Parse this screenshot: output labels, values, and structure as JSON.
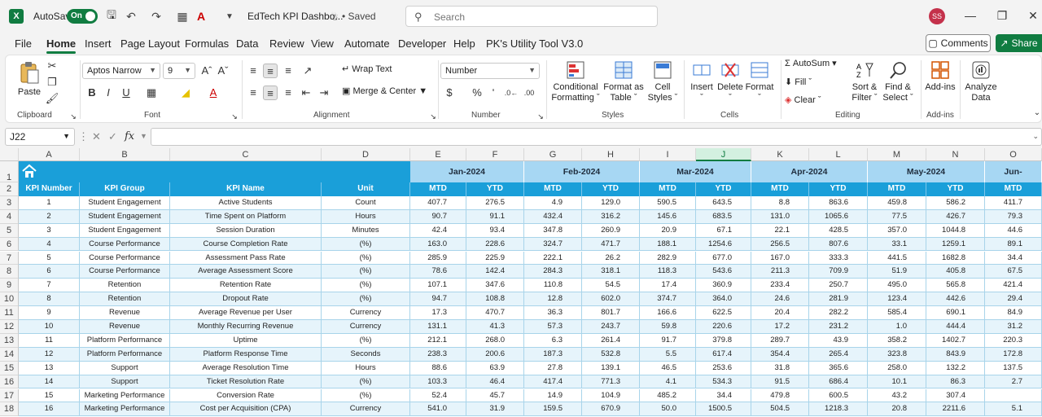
{
  "titlebar": {
    "autosave_label": "AutoSave",
    "autosave_state": "On",
    "doc_title": "EdTech KPI Dashbo...",
    "saved_status": "• Saved",
    "search_placeholder": "Search",
    "avatar_initials": "SS"
  },
  "menu": {
    "items": [
      "File",
      "Home",
      "Insert",
      "Page Layout",
      "Formulas",
      "Data",
      "Review",
      "View",
      "Automate",
      "Developer",
      "Help",
      "PK's Utility Tool V3.0"
    ],
    "active": "Home",
    "comments_label": "Comments",
    "share_label": "Share"
  },
  "ribbon": {
    "clipboard": {
      "paste": "Paste",
      "label": "Clipboard"
    },
    "font": {
      "name": "Aptos Narrow",
      "size": "9",
      "label": "Font"
    },
    "alignment": {
      "wrap": "Wrap Text",
      "merge": "Merge & Center",
      "label": "Alignment"
    },
    "number": {
      "format": "Number",
      "label": "Number"
    },
    "styles": {
      "conditional_1": "Conditional",
      "conditional_2": "Formatting",
      "format_table_1": "Format as",
      "format_table_2": "Table",
      "cell_styles_1": "Cell",
      "cell_styles_2": "Styles",
      "label": "Styles"
    },
    "cells": {
      "insert": "Insert",
      "delete": "Delete",
      "format": "Format",
      "label": "Cells"
    },
    "editing": {
      "autosum": "AutoSum",
      "fill": "Fill",
      "clear": "Clear",
      "sort_1": "Sort &",
      "sort_2": "Filter",
      "find_1": "Find &",
      "find_2": "Select",
      "label": "Editing"
    },
    "addins": {
      "button": "Add-ins",
      "label": "Add-ins"
    },
    "analyze": {
      "line1": "Analyze",
      "line2": "Data"
    }
  },
  "formula_bar": {
    "name_box": "J22",
    "fx": "fx",
    "content": ""
  },
  "sheet": {
    "selected_column": "J",
    "col_letters": [
      "A",
      "B",
      "C",
      "D",
      "E",
      "F",
      "G",
      "H",
      "I",
      "J",
      "K",
      "L",
      "M",
      "N",
      "O"
    ],
    "months": [
      "Jan-2024",
      "Feb-2024",
      "Mar-2024",
      "Apr-2024",
      "May-2024",
      "Jun-"
    ],
    "headers": [
      "KPI Number",
      "KPI Group",
      "KPI Name",
      "Unit",
      "MTD",
      "YTD",
      "MTD",
      "YTD",
      "MTD",
      "YTD",
      "MTD",
      "YTD",
      "MTD",
      "YTD",
      "MTD"
    ],
    "rows": [
      [
        "1",
        "Student Engagement",
        "Active Students",
        "Count",
        "407.7",
        "276.5",
        "4.9",
        "129.0",
        "590.5",
        "643.5",
        "8.8",
        "863.6",
        "459.8",
        "586.2",
        "411.7"
      ],
      [
        "2",
        "Student Engagement",
        "Time Spent on Platform",
        "Hours",
        "90.7",
        "91.1",
        "432.4",
        "316.2",
        "145.6",
        "683.5",
        "131.0",
        "1065.6",
        "77.5",
        "426.7",
        "79.3"
      ],
      [
        "3",
        "Student Engagement",
        "Session Duration",
        "Minutes",
        "42.4",
        "93.4",
        "347.8",
        "260.9",
        "20.9",
        "67.1",
        "22.1",
        "428.5",
        "357.0",
        "1044.8",
        "44.6"
      ],
      [
        "4",
        "Course Performance",
        "Course Completion Rate",
        "(%)",
        "163.0",
        "228.6",
        "324.7",
        "471.7",
        "188.1",
        "1254.6",
        "256.5",
        "807.6",
        "33.1",
        "1259.1",
        "89.1"
      ],
      [
        "5",
        "Course Performance",
        "Assessment Pass Rate",
        "(%)",
        "285.9",
        "225.9",
        "222.1",
        "26.2",
        "282.9",
        "677.0",
        "167.0",
        "333.3",
        "441.5",
        "1682.8",
        "34.4"
      ],
      [
        "6",
        "Course Performance",
        "Average Assessment Score",
        "(%)",
        "78.6",
        "142.4",
        "284.3",
        "318.1",
        "118.3",
        "543.6",
        "211.3",
        "709.9",
        "51.9",
        "405.8",
        "67.5"
      ],
      [
        "7",
        "Retention",
        "Retention Rate",
        "(%)",
        "107.1",
        "347.6",
        "110.8",
        "54.5",
        "17.4",
        "360.9",
        "233.4",
        "250.7",
        "495.0",
        "565.8",
        "421.4"
      ],
      [
        "8",
        "Retention",
        "Dropout Rate",
        "(%)",
        "94.7",
        "108.8",
        "12.8",
        "602.0",
        "374.7",
        "364.0",
        "24.6",
        "281.9",
        "123.4",
        "442.6",
        "29.4"
      ],
      [
        "9",
        "Revenue",
        "Average Revenue per User",
        "Currency",
        "17.3",
        "470.7",
        "36.3",
        "801.7",
        "166.6",
        "622.5",
        "20.4",
        "282.2",
        "585.4",
        "690.1",
        "84.9"
      ],
      [
        "10",
        "Revenue",
        "Monthly Recurring Revenue",
        "Currency",
        "131.1",
        "41.3",
        "57.3",
        "243.7",
        "59.8",
        "220.6",
        "17.2",
        "231.2",
        "1.0",
        "444.4",
        "31.2"
      ],
      [
        "11",
        "Platform Performance",
        "Uptime",
        "(%)",
        "212.1",
        "268.0",
        "6.3",
        "261.4",
        "91.7",
        "379.8",
        "289.7",
        "43.9",
        "358.2",
        "1402.7",
        "220.3"
      ],
      [
        "12",
        "Platform Performance",
        "Platform Response Time",
        "Seconds",
        "238.3",
        "200.6",
        "187.3",
        "532.8",
        "5.5",
        "617.4",
        "354.4",
        "265.4",
        "323.8",
        "843.9",
        "172.8"
      ],
      [
        "13",
        "Support",
        "Average Resolution Time",
        "Hours",
        "88.6",
        "63.9",
        "27.8",
        "139.1",
        "46.5",
        "253.6",
        "31.8",
        "365.6",
        "258.0",
        "132.2",
        "137.5"
      ],
      [
        "14",
        "Support",
        "Ticket Resolution Rate",
        "(%)",
        "103.3",
        "46.4",
        "417.4",
        "771.3",
        "4.1",
        "534.3",
        "91.5",
        "686.4",
        "10.1",
        "86.3",
        "2.7"
      ],
      [
        "15",
        "Marketing Performance",
        "Conversion Rate",
        "(%)",
        "52.4",
        "45.7",
        "14.9",
        "104.9",
        "485.2",
        "34.4",
        "479.8",
        "600.5",
        "43.2",
        "307.4",
        ""
      ],
      [
        "16",
        "Marketing Performance",
        "Cost per Acquisition (CPA)",
        "Currency",
        "541.0",
        "31.9",
        "159.5",
        "670.9",
        "50.0",
        "1500.5",
        "504.5",
        "1218.3",
        "20.8",
        "2211.6",
        "5.1"
      ]
    ]
  },
  "colors": {
    "excel_green": "#107c41",
    "header_blue": "#1a9fd9",
    "month_band": "#a7d7f3",
    "row_alt": "#e6f4fb"
  }
}
